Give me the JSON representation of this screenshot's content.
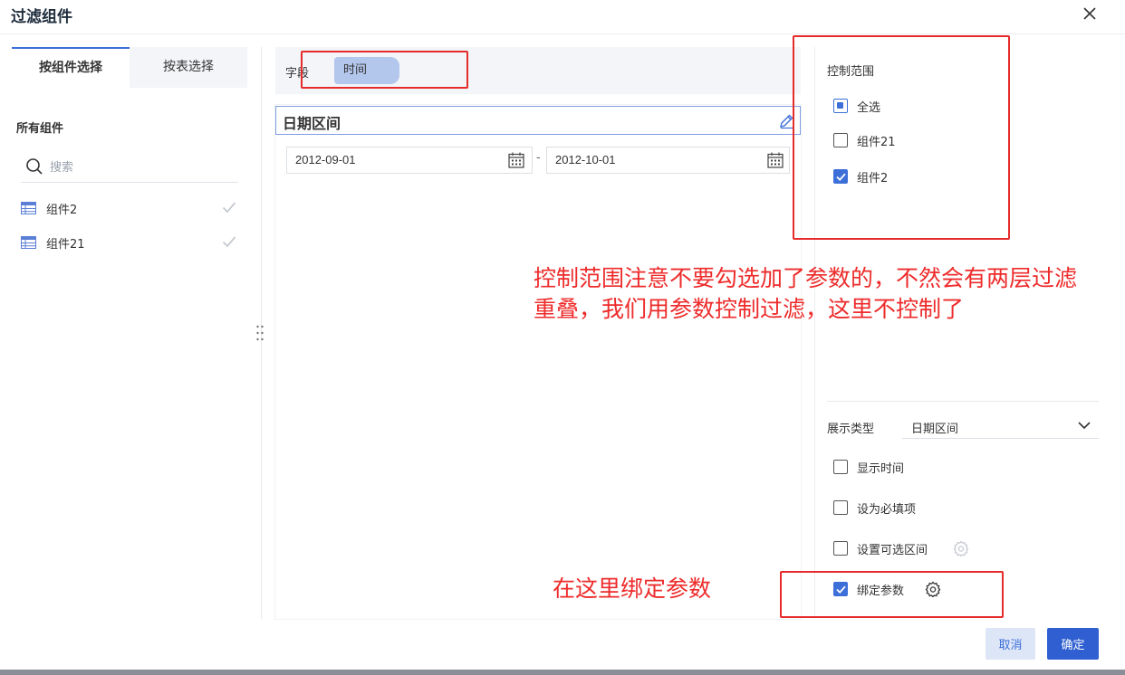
{
  "dialog": {
    "title": "过滤组件"
  },
  "left_panel": {
    "tabs": [
      {
        "label": "按组件选择"
      },
      {
        "label": "按表选择"
      }
    ],
    "section_title": "所有组件",
    "search": {
      "placeholder": "搜索",
      "value": ""
    },
    "components": [
      {
        "label": "组件2"
      },
      {
        "label": "组件21"
      }
    ]
  },
  "middle": {
    "field_label": "字段",
    "field_chip": "时间",
    "preview_title": "日期区间",
    "date_start": "2012-09-01",
    "date_separator": "-",
    "date_end": "2012-10-01"
  },
  "right_panel": {
    "control_title": "控制范围",
    "control_options": [
      {
        "label": "全选",
        "state": "partial"
      },
      {
        "label": "组件21",
        "state": "unchecked"
      },
      {
        "label": "组件2",
        "state": "checked"
      }
    ],
    "display_type_label": "展示类型",
    "display_type_value": "日期区间",
    "options": [
      {
        "label": "显示时间",
        "state": "unchecked"
      },
      {
        "label": "设为必填项",
        "state": "unchecked"
      },
      {
        "label": "设置可选区间",
        "state": "unchecked"
      },
      {
        "label": "绑定参数",
        "state": "checked"
      }
    ]
  },
  "annotations": {
    "note_control_line1": "控制范围注意不要勾选加了参数的，不然会有两层过滤",
    "note_control_line2": "重叠，我们用参数控制过滤，这里不控制了",
    "note_bind": "在这里绑定参数"
  },
  "footer": {
    "cancel_label": "取消",
    "ok_label": "确定"
  },
  "colors": {
    "accent": "#3d6fd9",
    "annotation_red": "#e62b2b",
    "chip_bg": "#b3c6ec"
  }
}
